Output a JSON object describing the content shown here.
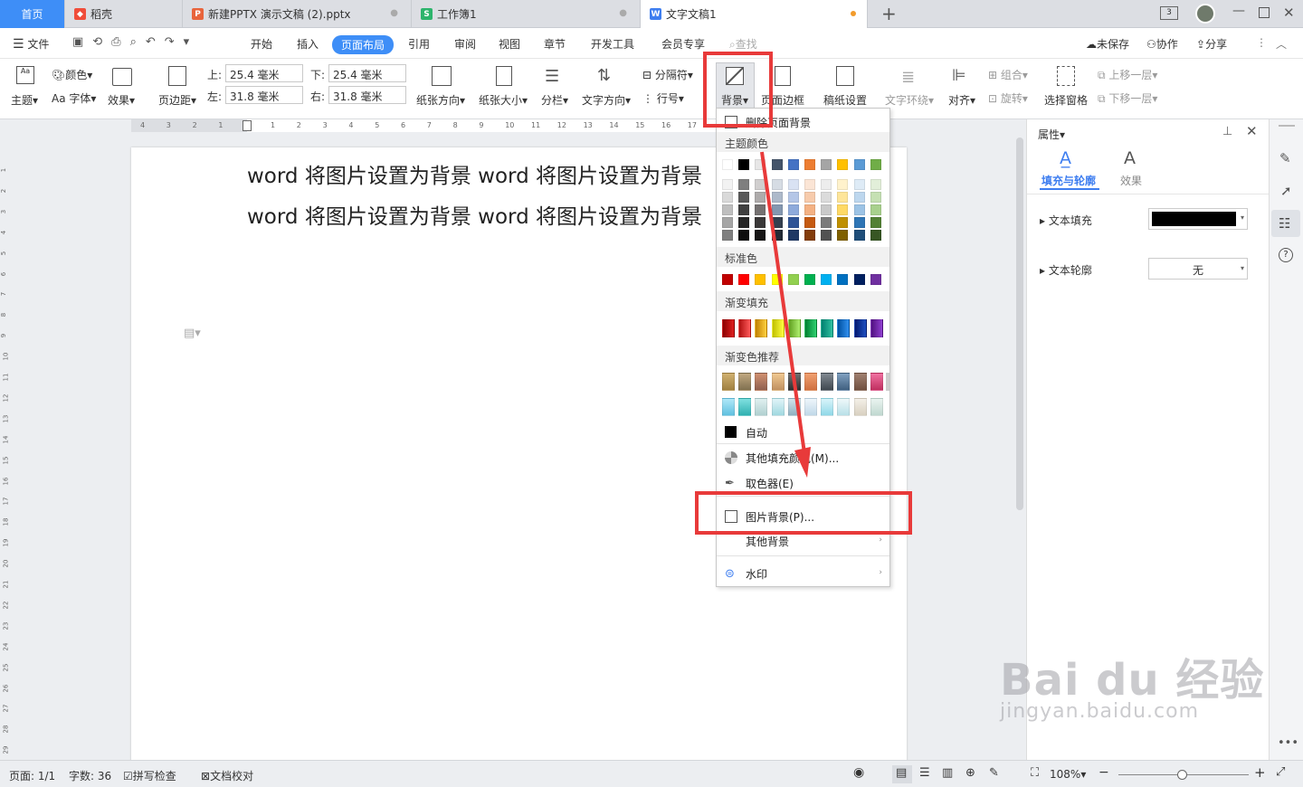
{
  "tabs": {
    "home": "首页",
    "t1": "稻壳",
    "t2": "新建PPTX 演示文稿 (2).pptx",
    "t3": "工作簿1",
    "t4": "文字文稿1",
    "badge": "3"
  },
  "menu": {
    "file": "文件",
    "items": [
      "开始",
      "插入",
      "页面布局",
      "引用",
      "审阅",
      "视图",
      "章节",
      "开发工具",
      "会员专享"
    ],
    "search": "查找",
    "unsaved": "未保存",
    "collab": "协作",
    "share": "分享"
  },
  "ribbon": {
    "theme": "主题",
    "color": "颜色",
    "font": "字体",
    "effect": "效果",
    "margin": "页边距",
    "top_label": "上:",
    "top_val": "25.4 毫米",
    "bottom_label": "下:",
    "bottom_val": "25.4 毫米",
    "left_label": "左:",
    "left_val": "31.8 毫米",
    "right_label": "右:",
    "right_val": "31.8 毫米",
    "orientation": "纸张方向",
    "size": "纸张大小",
    "columns": "分栏",
    "text_dir": "文字方向",
    "breaks": "分隔符",
    "line_num": "行号",
    "background": "背景",
    "page_border": "页面边框",
    "paper_set": "稿纸设置",
    "wrap": "文字环绕",
    "align": "对齐",
    "group": "组合",
    "rotate": "旋转",
    "select_pane": "选择窗格",
    "bring_up": "上移一层",
    "send_down": "下移一层"
  },
  "document": {
    "line1": "word 将图片设置为背景 word 将图片设置为背景",
    "line2": "word 将图片设置为背景 word 将图片设置为背景"
  },
  "ruler": {
    "h": [
      "4",
      "3",
      "2",
      "1",
      "",
      "1",
      "2",
      "3",
      "4",
      "5",
      "6",
      "7",
      "8",
      "9",
      "10",
      "11",
      "12",
      "13",
      "14",
      "15",
      "16",
      "17"
    ],
    "v": [
      "1",
      "2",
      "3",
      "4",
      "5",
      "6",
      "7",
      "8",
      "9",
      "10",
      "11",
      "12",
      "13",
      "14",
      "15",
      "16",
      "17",
      "18",
      "19",
      "20",
      "21",
      "22",
      "23",
      "24",
      "25",
      "26",
      "27",
      "28",
      "29"
    ]
  },
  "dropdown": {
    "delete_bg": "删除页面背景",
    "theme_colors": "主题颜色",
    "standard": "标准色",
    "gradient": "渐变填充",
    "gradient_rec": "渐变色推荐",
    "auto": "自动",
    "other_fill": "其他填充颜色(M)...",
    "picker": "取色器(E)",
    "picture_bg": "图片背景(P)...",
    "other_bg": "其他背景",
    "watermark": "水印",
    "theme_top": [
      "#ffffff",
      "#000000",
      "#e7e6e6",
      "#44546a",
      "#4472c4",
      "#ed7d31",
      "#a5a5a5",
      "#ffc000",
      "#5b9bd5",
      "#70ad47"
    ],
    "theme_cols": [
      [
        "#f2f2f2",
        "#d9d9d9",
        "#bfbfbf",
        "#a6a6a6",
        "#808080"
      ],
      [
        "#7f7f7f",
        "#595959",
        "#404040",
        "#262626",
        "#0d0d0d"
      ],
      [
        "#d0cece",
        "#aeabab",
        "#757171",
        "#3a3838",
        "#171616"
      ],
      [
        "#d6dce4",
        "#adb9ca",
        "#8497b0",
        "#333f4f",
        "#222a35"
      ],
      [
        "#d9e2f3",
        "#b4c6e7",
        "#8eaadb",
        "#2f5496",
        "#1f3864"
      ],
      [
        "#fbe5d5",
        "#f7cbac",
        "#f4b183",
        "#c55a11",
        "#833c0b"
      ],
      [
        "#ededed",
        "#dbdbdb",
        "#c9c9c9",
        "#7b7b7b",
        "#525252"
      ],
      [
        "#fff2cc",
        "#fee599",
        "#ffd965",
        "#bf9000",
        "#7f6000"
      ],
      [
        "#deebf6",
        "#bdd7ee",
        "#9cc3e5",
        "#2e75b5",
        "#1f4e79"
      ],
      [
        "#e2efd9",
        "#c5e0b3",
        "#a8d08d",
        "#538135",
        "#375623"
      ]
    ],
    "standard_colors": [
      "#c00000",
      "#ff0000",
      "#ffc000",
      "#ffff00",
      "#92d050",
      "#00b050",
      "#00b0f0",
      "#0070c0",
      "#002060",
      "#7030a0"
    ],
    "gradient_colors": [
      [
        "#8b0000",
        "#e02020"
      ],
      [
        "#b01010",
        "#ff5a5a"
      ],
      [
        "#c08000",
        "#ffd040"
      ],
      [
        "#c0c000",
        "#ffff40"
      ],
      [
        "#60a020",
        "#b0f070"
      ],
      [
        "#008030",
        "#30d070"
      ],
      [
        "#008070",
        "#30c0a0"
      ],
      [
        "#0050a0",
        "#3090f0"
      ],
      [
        "#001870",
        "#2050c0"
      ],
      [
        "#501080",
        "#9040d0"
      ]
    ],
    "rec_row1": [
      [
        "#a08040",
        "#d0b070"
      ],
      [
        "#807050",
        "#c0a880"
      ],
      [
        "#906050",
        "#d09070"
      ],
      [
        "#c09060",
        "#f0c890"
      ],
      [
        "#303030",
        "#707070"
      ],
      [
        "#d07040",
        "#f0a070"
      ],
      [
        "#404850",
        "#808890"
      ],
      [
        "#406080",
        "#80a0c0"
      ],
      [
        "#705040",
        "#a08070"
      ],
      [
        "#c03060",
        "#f070a0"
      ]
    ],
    "rec_row2": [
      [
        "#60c0e0",
        "#b0e8f8"
      ],
      [
        "#30b0b0",
        "#80e0e0"
      ],
      [
        "#b0d0d0",
        "#e0f0f0"
      ],
      [
        "#a0d8e0",
        "#e0f4f8"
      ],
      [
        "#90b0c0",
        "#d0e4ec"
      ],
      [
        "#c0d8e8",
        "#eef6fb"
      ],
      [
        "#90d8e8",
        "#d8f4fa"
      ],
      [
        "#b8e0e8",
        "#eef8fa"
      ],
      [
        "#d8d0c0",
        "#f4f0e8"
      ],
      [
        "#c0d8d0",
        "#eaf4f0"
      ]
    ]
  },
  "panel": {
    "title": "属性",
    "tab_fill": "填充与轮廓",
    "tab_effect": "效果",
    "text_fill": "文本填充",
    "text_outline": "文本轮廓",
    "none": "无"
  },
  "status": {
    "page": "页面: 1/1",
    "words": "字数: 36",
    "spell": "拼写检查",
    "proof": "文档校对",
    "zoom": "108%"
  },
  "watermark": {
    "brand": "Bai du 经验",
    "url": "jingyan.baidu.com"
  }
}
